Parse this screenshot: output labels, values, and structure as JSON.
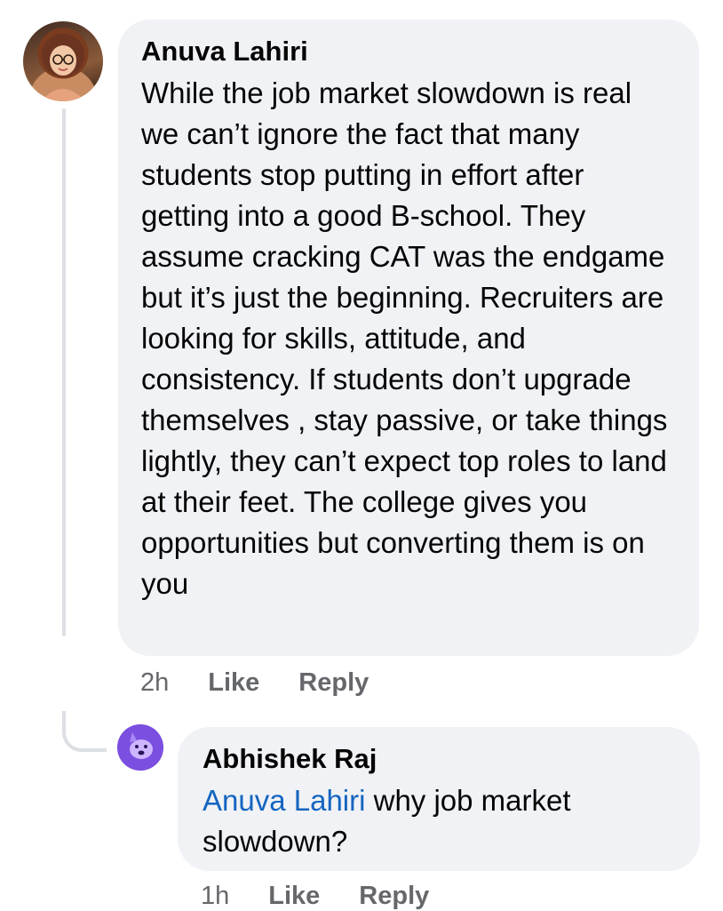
{
  "comment": {
    "author": "Anuva Lahiri",
    "text": "While the job market slowdown is real we can’t ignore the fact that many students stop putting in effort after getting into a good B-school. They assume cracking CAT was the endgame but it’s just the beginning. Recruiters are looking for skills, attitude, and consistency. If students don’t upgrade themselves , stay passive, or take things lightly, they can’t expect top roles to land at their feet. The college gives you opportunities but converting them is on you",
    "time": "2h",
    "like_label": "Like",
    "reply_label": "Reply"
  },
  "reply": {
    "author": "Abhishek Raj",
    "mention": "Anuva Lahiri",
    "text": " why job market slowdown?",
    "time": "1h",
    "like_label": "Like",
    "reply_label": "Reply"
  },
  "colors": {
    "bubble": "#f0f2f5",
    "mention": "#1565c0",
    "meta": "#65676b"
  }
}
